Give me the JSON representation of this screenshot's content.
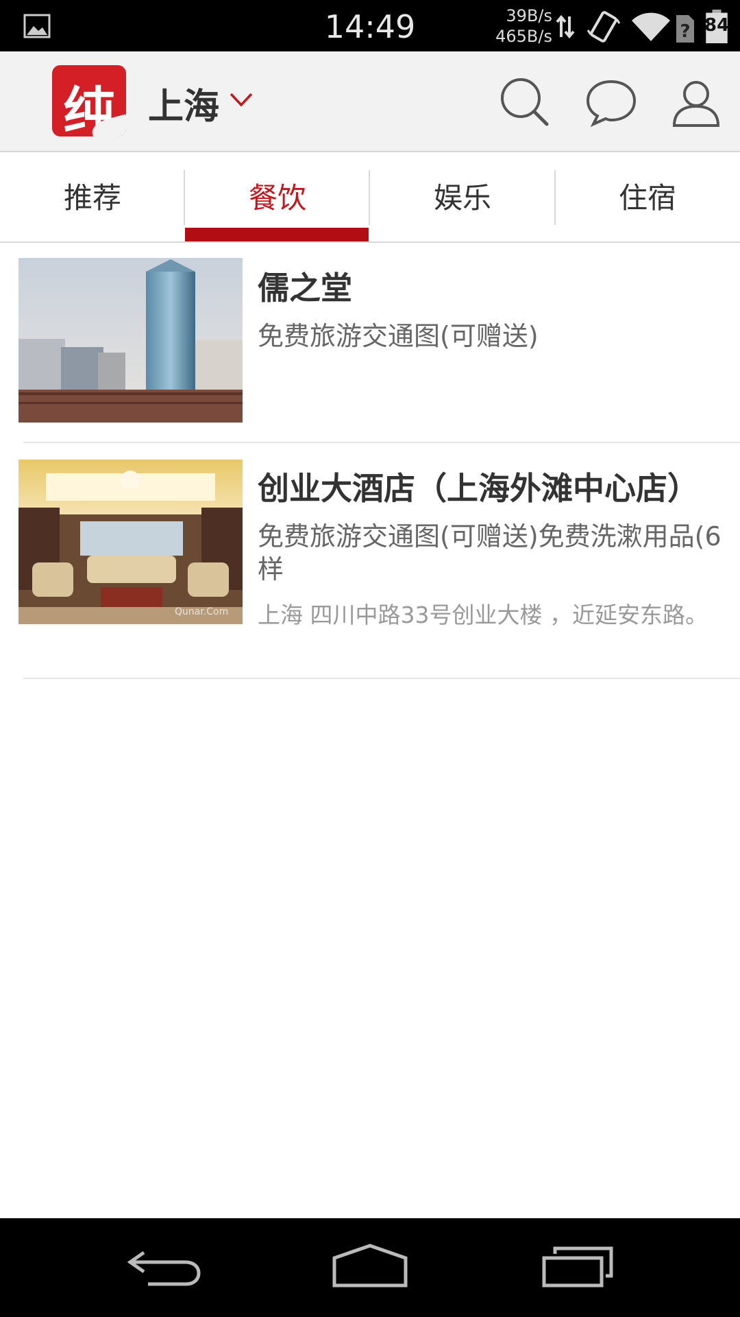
{
  "status_bar": {
    "time": "14:49",
    "upload_speed": "39B/s",
    "download_speed": "465B/s",
    "battery": "84",
    "icons": [
      "gallery-icon",
      "data-arrows-icon",
      "vibrate-icon",
      "wifi-icon",
      "no-sim-icon",
      "battery-icon"
    ]
  },
  "app_bar": {
    "logo_char": "纯",
    "city": "上海",
    "actions": [
      "search-icon",
      "message-icon",
      "user-icon"
    ]
  },
  "tabs": [
    {
      "label": "推荐",
      "active": false
    },
    {
      "label": "餐饮",
      "active": true
    },
    {
      "label": "娱乐",
      "active": false
    },
    {
      "label": "住宿",
      "active": false
    }
  ],
  "items": [
    {
      "title": "儒之堂",
      "desc": "免费旅游交通图(可赠送)",
      "address": ""
    },
    {
      "title": "创业大酒店（上海外滩中心店）",
      "desc": "免费旅游交通图(可赠送)免费洗漱用品(6样",
      "address": "上海 四川中路33号创业大楼 ，近延安东路。",
      "watermark": "Qunar.Com"
    }
  ],
  "colors": {
    "accent": "#c4161c",
    "indicator": "#b10d12",
    "app_bar_bg": "#f2f2f2"
  },
  "nav_bar": [
    "back-icon",
    "home-icon",
    "recent-apps-icon"
  ]
}
